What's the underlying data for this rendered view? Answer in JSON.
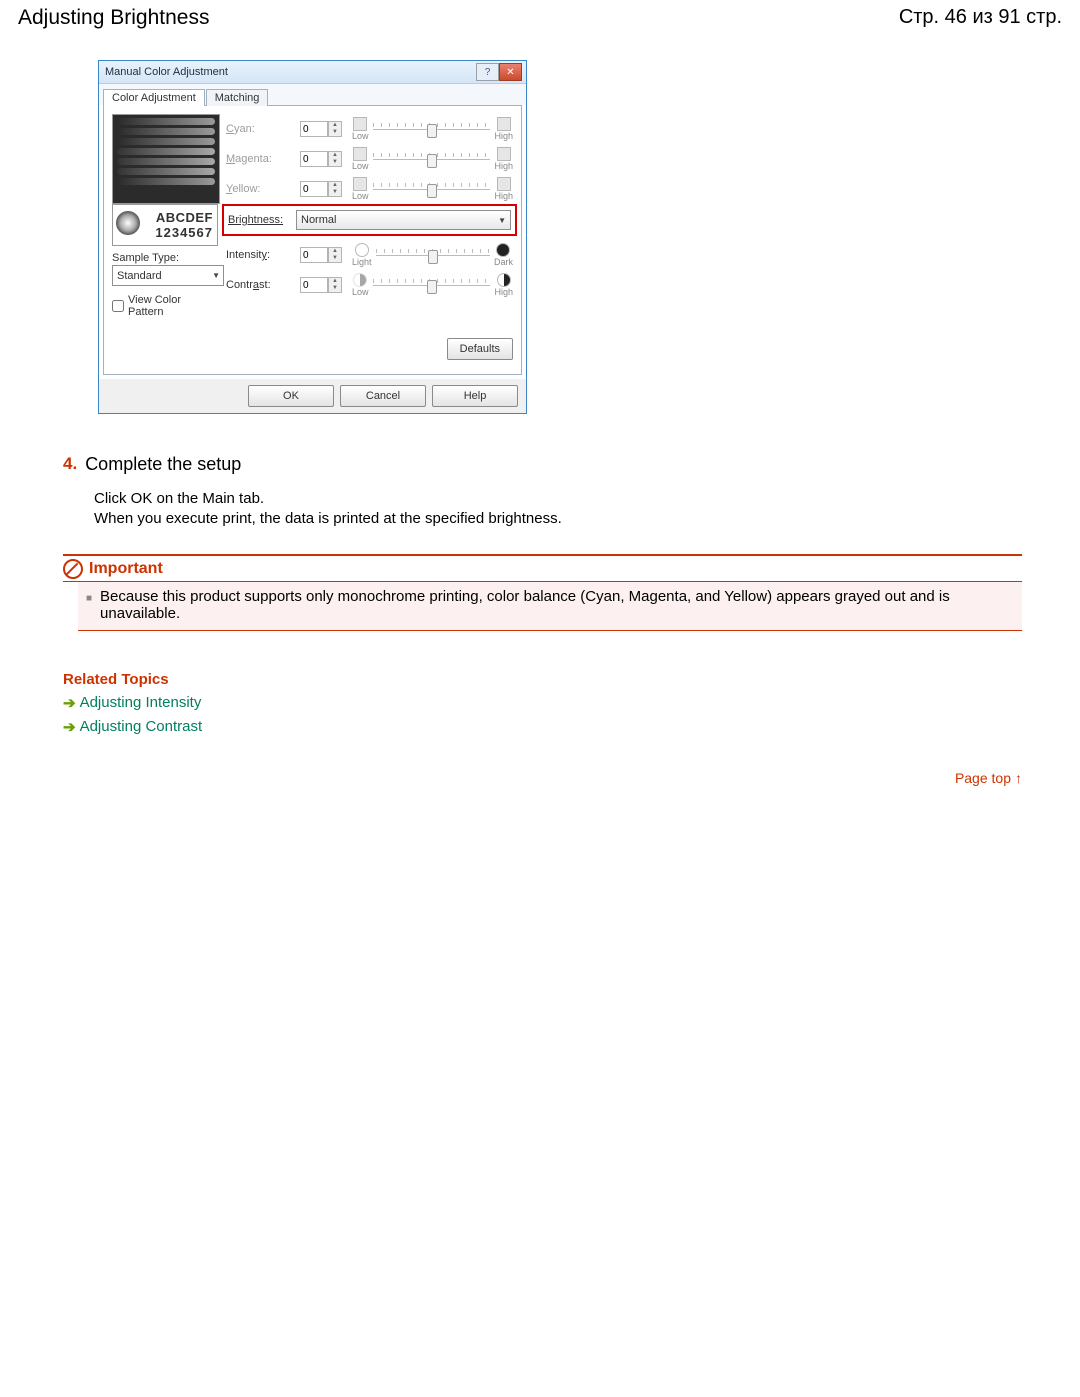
{
  "header": {
    "title": "Adjusting Brightness",
    "page_info": "Стр. 46 из 91 стр."
  },
  "window": {
    "title": "Manual Color Adjustment",
    "tabs": {
      "color_adj": "Color Adjustment",
      "matching": "Matching"
    },
    "cyan": {
      "label": "Cyan:",
      "value": "0",
      "low": "Low",
      "high": "High"
    },
    "magenta": {
      "label": "Magenta:",
      "value": "0",
      "low": "Low",
      "high": "High"
    },
    "yellow": {
      "label": "Yellow:",
      "value": "0",
      "low": "Low",
      "high": "High"
    },
    "brightness": {
      "label": "Brightness:",
      "value": "Normal"
    },
    "intensity": {
      "label": "Intensity:",
      "value": "0",
      "low": "Light",
      "high": "Dark"
    },
    "contrast": {
      "label": "Contrast:",
      "value": "0",
      "low": "Low",
      "high": "High"
    },
    "sample_type_label": "Sample Type:",
    "sample_type_value": "Standard",
    "view_color_pattern": "View Color Pattern",
    "preview_l1": "ABCDEF",
    "preview_l2": "1234567",
    "defaults_btn": "Defaults",
    "ok": "OK",
    "cancel": "Cancel",
    "help": "Help"
  },
  "step": {
    "num": "4.",
    "title": "Complete the setup",
    "line1": "Click OK on the Main tab.",
    "line2": "When you execute print, the data is printed at the specified brightness."
  },
  "important": {
    "heading": "Important",
    "text": "Because this product supports only monochrome printing, color balance (Cyan, Magenta, and Yellow) appears grayed out and is unavailable."
  },
  "related": {
    "heading": "Related Topics",
    "links": {
      "intensity": "Adjusting Intensity",
      "contrast": "Adjusting Contrast"
    }
  },
  "page_top": "Page top"
}
